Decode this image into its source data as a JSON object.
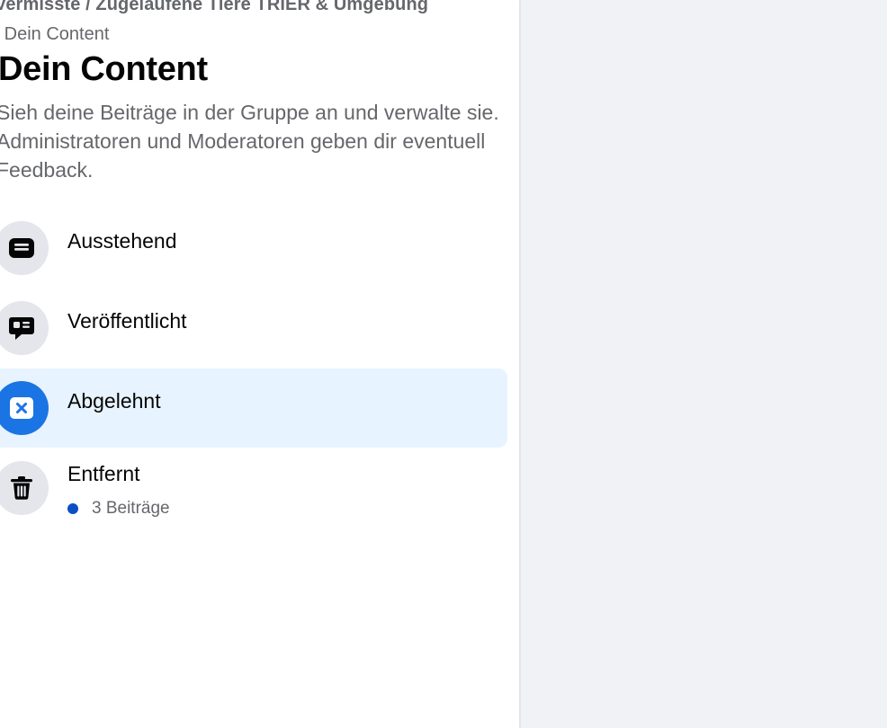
{
  "group": {
    "name": "Vermisste / Zugelaufene Tiere TRIER & Umgebung",
    "breadcrumb_separator": "·",
    "breadcrumb_current": "Dein Content"
  },
  "page": {
    "title": "Dein Content",
    "description": "Sieh deine Beiträge in der Gruppe an und verwalte sie. Administratoren und Moderatoren geben dir eventuell Feedback."
  },
  "menu": {
    "items": [
      {
        "label": "Ausstehend",
        "icon": "pending-posts-icon"
      },
      {
        "label": "Veröffentlicht",
        "icon": "published-posts-icon"
      },
      {
        "label": "Abgelehnt",
        "icon": "declined-posts-icon",
        "selected": true
      },
      {
        "label": "Entfernt",
        "icon": "trash-icon",
        "sub_text": "3 Beiträge"
      }
    ]
  },
  "colors": {
    "accent": "#1b74e4",
    "selected_background": "#e7f3ff",
    "icon_background": "#e4e6eb",
    "badge_dot": "#0a4fc4",
    "secondary_text": "#65676b",
    "primary_text": "#050505",
    "page_background": "#f0f2f5"
  }
}
